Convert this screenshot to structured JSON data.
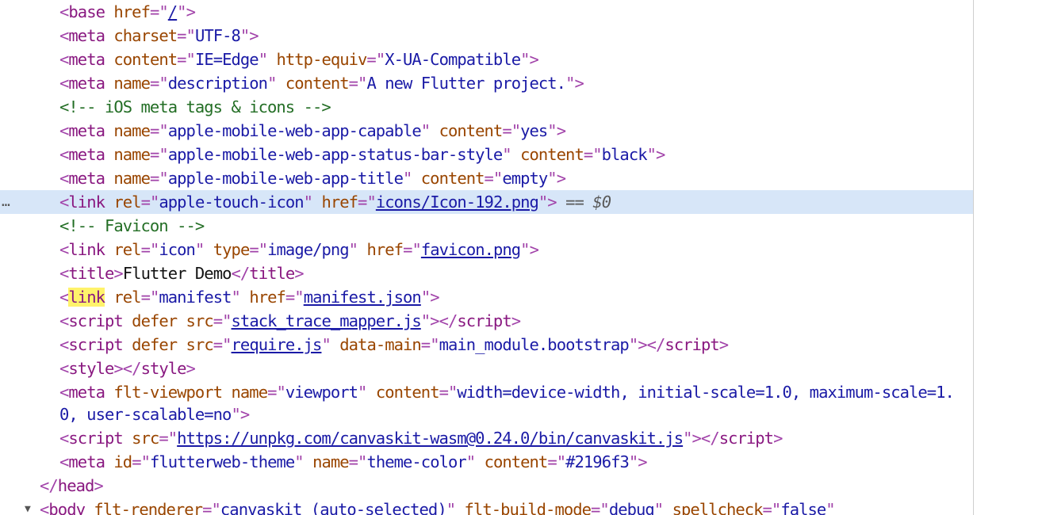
{
  "ui": {
    "ellipsis": "…",
    "eq_marker": "==",
    "selected_var": "$0",
    "collapse_toggle": "▼"
  },
  "lines": [
    {
      "indent": 2,
      "segments": [
        [
          "br",
          "<"
        ],
        [
          "tag",
          "base"
        ],
        [
          "tx",
          " "
        ],
        [
          "an",
          "href"
        ],
        [
          "br",
          "=\""
        ],
        [
          "link",
          "/"
        ],
        [
          "br",
          "\">"
        ]
      ]
    },
    {
      "indent": 2,
      "segments": [
        [
          "br",
          "<"
        ],
        [
          "tag",
          "meta"
        ],
        [
          "tx",
          " "
        ],
        [
          "an",
          "charset"
        ],
        [
          "br",
          "=\""
        ],
        [
          "av",
          "UTF-8"
        ],
        [
          "br",
          "\">"
        ]
      ]
    },
    {
      "indent": 2,
      "segments": [
        [
          "br",
          "<"
        ],
        [
          "tag",
          "meta"
        ],
        [
          "tx",
          " "
        ],
        [
          "an",
          "content"
        ],
        [
          "br",
          "=\""
        ],
        [
          "av",
          "IE=Edge"
        ],
        [
          "br",
          "\""
        ],
        [
          "tx",
          " "
        ],
        [
          "an",
          "http-equiv"
        ],
        [
          "br",
          "=\""
        ],
        [
          "av",
          "X-UA-Compatible"
        ],
        [
          "br",
          "\">"
        ]
      ]
    },
    {
      "indent": 2,
      "segments": [
        [
          "br",
          "<"
        ],
        [
          "tag",
          "meta"
        ],
        [
          "tx",
          " "
        ],
        [
          "an",
          "name"
        ],
        [
          "br",
          "=\""
        ],
        [
          "av",
          "description"
        ],
        [
          "br",
          "\""
        ],
        [
          "tx",
          " "
        ],
        [
          "an",
          "content"
        ],
        [
          "br",
          "=\""
        ],
        [
          "av",
          "A new Flutter project."
        ],
        [
          "br",
          "\">"
        ]
      ]
    },
    {
      "indent": 2,
      "segments": [
        [
          "cm",
          "<!-- iOS meta tags & icons -->"
        ]
      ]
    },
    {
      "indent": 2,
      "segments": [
        [
          "br",
          "<"
        ],
        [
          "tag",
          "meta"
        ],
        [
          "tx",
          " "
        ],
        [
          "an",
          "name"
        ],
        [
          "br",
          "=\""
        ],
        [
          "av",
          "apple-mobile-web-app-capable"
        ],
        [
          "br",
          "\""
        ],
        [
          "tx",
          " "
        ],
        [
          "an",
          "content"
        ],
        [
          "br",
          "=\""
        ],
        [
          "av",
          "yes"
        ],
        [
          "br",
          "\">"
        ]
      ]
    },
    {
      "indent": 2,
      "segments": [
        [
          "br",
          "<"
        ],
        [
          "tag",
          "meta"
        ],
        [
          "tx",
          " "
        ],
        [
          "an",
          "name"
        ],
        [
          "br",
          "=\""
        ],
        [
          "av",
          "apple-mobile-web-app-status-bar-style"
        ],
        [
          "br",
          "\""
        ],
        [
          "tx",
          " "
        ],
        [
          "an",
          "content"
        ],
        [
          "br",
          "=\""
        ],
        [
          "av",
          "black"
        ],
        [
          "br",
          "\">"
        ]
      ]
    },
    {
      "indent": 2,
      "segments": [
        [
          "br",
          "<"
        ],
        [
          "tag",
          "meta"
        ],
        [
          "tx",
          " "
        ],
        [
          "an",
          "name"
        ],
        [
          "br",
          "=\""
        ],
        [
          "av",
          "apple-mobile-web-app-title"
        ],
        [
          "br",
          "\""
        ],
        [
          "tx",
          " "
        ],
        [
          "an",
          "content"
        ],
        [
          "br",
          "=\""
        ],
        [
          "av",
          "empty"
        ],
        [
          "br",
          "\">"
        ]
      ]
    },
    {
      "indent": 2,
      "selected": true,
      "segments": [
        [
          "br",
          "<"
        ],
        [
          "tag",
          "link"
        ],
        [
          "tx",
          " "
        ],
        [
          "an",
          "rel"
        ],
        [
          "br",
          "=\""
        ],
        [
          "av",
          "apple-touch-icon"
        ],
        [
          "br",
          "\""
        ],
        [
          "tx",
          " "
        ],
        [
          "an",
          "href"
        ],
        [
          "br",
          "=\""
        ],
        [
          "link",
          "icons/Icon-192.png"
        ],
        [
          "br",
          "\">"
        ]
      ]
    },
    {
      "indent": 2,
      "segments": [
        [
          "cm",
          "<!-- Favicon -->"
        ]
      ]
    },
    {
      "indent": 2,
      "segments": [
        [
          "br",
          "<"
        ],
        [
          "tag",
          "link"
        ],
        [
          "tx",
          " "
        ],
        [
          "an",
          "rel"
        ],
        [
          "br",
          "=\""
        ],
        [
          "av",
          "icon"
        ],
        [
          "br",
          "\""
        ],
        [
          "tx",
          " "
        ],
        [
          "an",
          "type"
        ],
        [
          "br",
          "=\""
        ],
        [
          "av",
          "image/png"
        ],
        [
          "br",
          "\""
        ],
        [
          "tx",
          " "
        ],
        [
          "an",
          "href"
        ],
        [
          "br",
          "=\""
        ],
        [
          "link",
          "favicon.png"
        ],
        [
          "br",
          "\">"
        ]
      ]
    },
    {
      "indent": 2,
      "segments": [
        [
          "br",
          "<"
        ],
        [
          "tag",
          "title"
        ],
        [
          "br",
          ">"
        ],
        [
          "tx",
          "Flutter Demo"
        ],
        [
          "br",
          "</"
        ],
        [
          "tag",
          "title"
        ],
        [
          "br",
          ">"
        ]
      ]
    },
    {
      "indent": 2,
      "segments": [
        [
          "br",
          "<"
        ],
        [
          "hl",
          "link"
        ],
        [
          "tx",
          " "
        ],
        [
          "an",
          "rel"
        ],
        [
          "br",
          "=\""
        ],
        [
          "av",
          "manifest"
        ],
        [
          "br",
          "\""
        ],
        [
          "tx",
          " "
        ],
        [
          "an",
          "href"
        ],
        [
          "br",
          "=\""
        ],
        [
          "link",
          "manifest.json"
        ],
        [
          "br",
          "\">"
        ]
      ]
    },
    {
      "indent": 2,
      "segments": [
        [
          "br",
          "<"
        ],
        [
          "tag",
          "script"
        ],
        [
          "tx",
          " "
        ],
        [
          "an",
          "defer"
        ],
        [
          "tx",
          " "
        ],
        [
          "an",
          "src"
        ],
        [
          "br",
          "=\""
        ],
        [
          "link",
          "stack_trace_mapper.js"
        ],
        [
          "br",
          "\">"
        ],
        [
          "br",
          "</"
        ],
        [
          "tag",
          "script"
        ],
        [
          "br",
          ">"
        ]
      ]
    },
    {
      "indent": 2,
      "segments": [
        [
          "br",
          "<"
        ],
        [
          "tag",
          "script"
        ],
        [
          "tx",
          " "
        ],
        [
          "an",
          "defer"
        ],
        [
          "tx",
          " "
        ],
        [
          "an",
          "src"
        ],
        [
          "br",
          "=\""
        ],
        [
          "link",
          "require.js"
        ],
        [
          "br",
          "\""
        ],
        [
          "tx",
          " "
        ],
        [
          "an",
          "data-main"
        ],
        [
          "br",
          "=\""
        ],
        [
          "av",
          "main_module.bootstrap"
        ],
        [
          "br",
          "\">"
        ],
        [
          "br",
          "</"
        ],
        [
          "tag",
          "script"
        ],
        [
          "br",
          ">"
        ]
      ]
    },
    {
      "indent": 2,
      "segments": [
        [
          "br",
          "<"
        ],
        [
          "tag",
          "style"
        ],
        [
          "br",
          ">"
        ],
        [
          "br",
          "</"
        ],
        [
          "tag",
          "style"
        ],
        [
          "br",
          ">"
        ]
      ]
    },
    {
      "indent": 2,
      "wrap": true,
      "segments": [
        [
          "br",
          "<"
        ],
        [
          "tag",
          "meta"
        ],
        [
          "tx",
          " "
        ],
        [
          "an",
          "flt-viewport"
        ],
        [
          "tx",
          " "
        ],
        [
          "an",
          "name"
        ],
        [
          "br",
          "=\""
        ],
        [
          "av",
          "viewport"
        ],
        [
          "br",
          "\""
        ],
        [
          "tx",
          " "
        ],
        [
          "an",
          "content"
        ],
        [
          "br",
          "=\""
        ],
        [
          "av",
          "width=device-width, initial-scale=1.0, maximum-scale=1.0, user-scalable=no"
        ],
        [
          "br",
          "\">"
        ]
      ]
    },
    {
      "indent": 2,
      "segments": [
        [
          "br",
          "<"
        ],
        [
          "tag",
          "script"
        ],
        [
          "tx",
          " "
        ],
        [
          "an",
          "src"
        ],
        [
          "br",
          "=\""
        ],
        [
          "link",
          "https://unpkg.com/canvaskit-wasm@0.24.0/bin/canvaskit.js"
        ],
        [
          "br",
          "\">"
        ],
        [
          "br",
          "</"
        ],
        [
          "tag",
          "script"
        ],
        [
          "br",
          ">"
        ]
      ]
    },
    {
      "indent": 2,
      "segments": [
        [
          "br",
          "<"
        ],
        [
          "tag",
          "meta"
        ],
        [
          "tx",
          " "
        ],
        [
          "an",
          "id"
        ],
        [
          "br",
          "=\""
        ],
        [
          "av",
          "flutterweb-theme"
        ],
        [
          "br",
          "\""
        ],
        [
          "tx",
          " "
        ],
        [
          "an",
          "name"
        ],
        [
          "br",
          "=\""
        ],
        [
          "av",
          "theme-color"
        ],
        [
          "br",
          "\""
        ],
        [
          "tx",
          " "
        ],
        [
          "an",
          "content"
        ],
        [
          "br",
          "=\""
        ],
        [
          "av",
          "#2196f3"
        ],
        [
          "br",
          "\">"
        ]
      ]
    },
    {
      "indent": 1,
      "segments": [
        [
          "br",
          "</"
        ],
        [
          "tag",
          "head"
        ],
        [
          "br",
          ">"
        ]
      ]
    },
    {
      "indent": 1,
      "toggle": true,
      "segments": [
        [
          "br",
          "<"
        ],
        [
          "tag",
          "body"
        ],
        [
          "tx",
          " "
        ],
        [
          "an",
          "flt-renderer"
        ],
        [
          "br",
          "=\""
        ],
        [
          "av",
          "canvaskit (auto-selected)"
        ],
        [
          "br",
          "\""
        ],
        [
          "tx",
          " "
        ],
        [
          "an",
          "flt-build-mode"
        ],
        [
          "br",
          "=\""
        ],
        [
          "av",
          "debug"
        ],
        [
          "br",
          "\""
        ],
        [
          "tx",
          " "
        ],
        [
          "an",
          "spellcheck"
        ],
        [
          "br",
          "=\""
        ],
        [
          "av",
          "false"
        ],
        [
          "br",
          "\""
        ]
      ]
    }
  ]
}
